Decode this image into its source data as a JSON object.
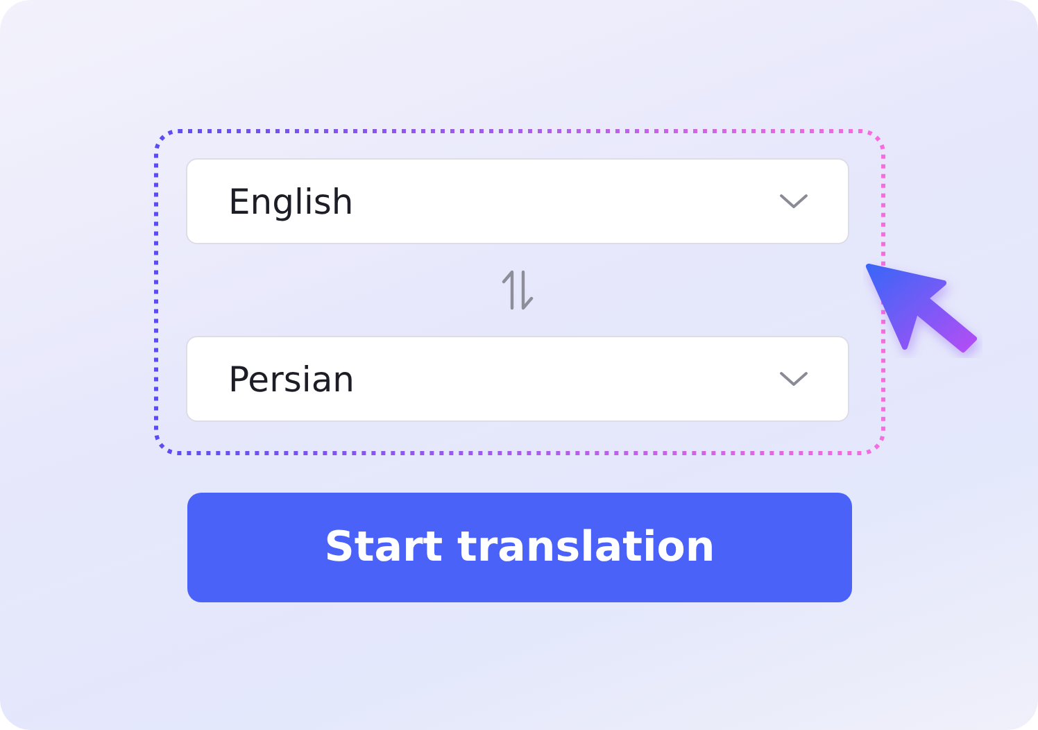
{
  "language_selects": [
    {
      "value": "English"
    },
    {
      "value": "Persian"
    }
  ],
  "start_button": {
    "label": "Start translation"
  }
}
